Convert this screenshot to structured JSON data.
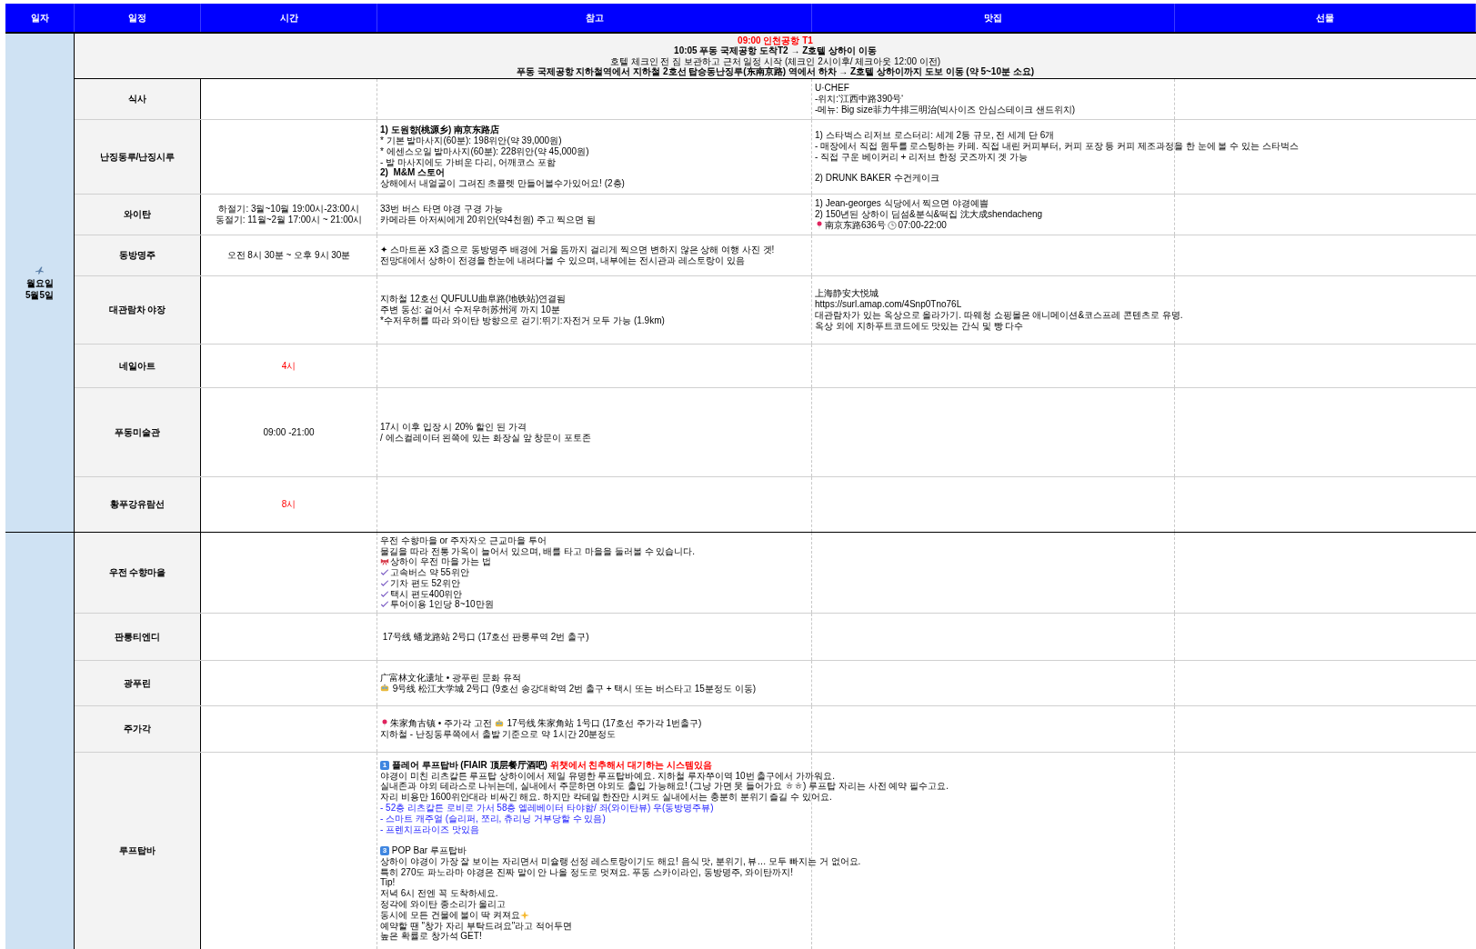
{
  "columns": [
    "일자",
    "일정",
    "시간",
    "참고",
    "맛집",
    "선물"
  ],
  "days": [
    {
      "weekday": "월요일",
      "date": "5월5일",
      "banner": [
        {
          "text": "09:00 인천공항 T1",
          "kind": "alert"
        },
        {
          "text": "10:05 푸동 국제공항 도착T2 →  Z호텔 상하이 이동",
          "kind": "heading"
        },
        {
          "text": "호텔 체크인 전 짐 보관하고 근처 일정 시작 (체크인 2시이후/ 체크아웃 12:00 이전)"
        },
        {
          "text": "푸동 국제공항 지하철역에서 지하철 2호선 탑승동난징루(东南京路) 역에서 하차 → Z호텔 상하이까지 도보 이동 (약 5~10분 소요)",
          "kind": "heading"
        }
      ],
      "rows": [
        {
          "place": "식사",
          "note": [],
          "food": [
            {
              "text": "U·CHEF"
            },
            {
              "text": "-위치:‘江西中路390号‘"
            },
            {
              "text": "-메뉴: Big size菲力牛排三明治(빅사이즈 안심스테이크 샌드위치)"
            }
          ]
        },
        {
          "place": "난징동루/난징시루",
          "note": [
            {
              "text": "1) 도원향(桃源乡) 南京东路店",
              "kind": "heading"
            },
            {
              "text": "* 기본 발마사지(60분): 198위안(약 39,000원)"
            },
            {
              "text": "* 에센스오일 발마사지(60분): 228위안(약 45,000원)"
            },
            {
              "text": "- 발 마사지에도 가벼운 다리, 어깨코스 포함"
            },
            {
              "text": "2)  M&M 스토어",
              "kind": "heading"
            },
            {
              "text": "상해에서 내얼굴이 그려진 초콜렛 만들어볼수가있어요! (2층)"
            }
          ],
          "food": [
            {
              "text": "1) 스타벅스 리저브 로스터리: 세계 2등 규모, 전 세계 단 6개"
            },
            {
              "text": "- 매장에서 직접 원두를 로스팅하는 카페. 직접 내린 커피부터, 커피 포장 등 커피 제조과정을 한 눈에 볼 수 있는 스타벅스"
            },
            {
              "text": "- 직접 구운 베이커리 + 리저브 한정 굿즈까지 겟 가능",
              "gap_after": true
            },
            {
              "text": "2) DRUNK BAKER 수건케이크"
            }
          ]
        },
        {
          "place": "와이탄",
          "time": [
            {
              "text": "하절기: 3월~10월 19:00시-23:00시"
            },
            {
              "text": "동절기: 11월~2월 17:00시 ~ 21:00시"
            }
          ],
          "note": [
            {
              "text": "33번 버스 타면 야경 구경 가능"
            },
            {
              "text": "카메라든 아저씨에게 20위안(약4천원) 주고 찍으면 됨"
            }
          ],
          "food": [
            {
              "text": "1) Jean-georges 식당에서 찍으면 야경예쁨"
            },
            {
              "text": "2) 150년된 상하이 딤섬&분식&떡집 沈大成shendacheng"
            },
            {
              "parts": [
                {
                  "kind": "pin"
                },
                {
                  "text": "南京东路636号 "
                },
                {
                  "kind": "clock"
                },
                {
                  "text": "07:00-22:00"
                }
              ]
            }
          ]
        },
        {
          "place": "동방명주",
          "time": [
            {
              "text": "오전 8시 30분 ~ 오후 9시 30분"
            }
          ],
          "note": [
            {
              "text": "✦ 스마트폰 x3 줌으로 동방명주 배경에 거울 돔까지 걸리게 찍으면 변하지 않은 상해 여행 사진 겟!"
            },
            {
              "text": "전망대에서 상하이 전경을 한눈에 내려다볼 수 있으며, 내부에는 전시관과 레스토랑이 있음"
            }
          ],
          "food": []
        },
        {
          "place": "대관람차 야장",
          "note": [
            {
              "text": "지하철 12호선 QUFULU曲阜路(地铁站)연결됨"
            },
            {
              "text": "주변 동선: 걸어서 수저우허苏州河 까지 10분"
            },
            {
              "text": "*수저우허를 따라 와이탄 방향으로 걷기:뛰기:자전거 모두 가능 (1.9km)"
            }
          ],
          "food": [
            {
              "text": "上海静安大悦城"
            },
            {
              "text": "https://surl.amap.com/4Snp0Tno76L"
            },
            {
              "text": "대관람차가 있는 옥상으로 올라가기. 따웨청 쇼핑몰은 애니메이션&코스프레 콘텐츠로 유명."
            },
            {
              "text": "옥상 외에 지하푸트코드에도 맛있는 간식 및 빵 다수"
            }
          ]
        },
        {
          "place": "네일아트",
          "time": [
            {
              "text": "4시",
              "kind": "highlight"
            }
          ],
          "note": [],
          "food": []
        },
        {
          "place": "푸동미술관",
          "time": [
            {
              "text": "09:00 -21:00"
            }
          ],
          "note": [
            {
              "text": "17시 이후 입장 시 20% 할인 된 가격"
            },
            {
              "text": "/ 에스컬레이터 왼쪽에 있는 화장실 앞 창문이 포토존"
            }
          ],
          "food": []
        },
        {
          "place": "황푸강유람선",
          "time": [
            {
              "text": "8시",
              "kind": "highlight"
            }
          ],
          "note": [],
          "food": []
        }
      ]
    },
    {
      "rows": [
        {
          "place": "우전 수향마을",
          "note": [
            {
              "text": "우전 수향마을 or 주자자오 근교마을 투어"
            },
            {
              "text": "물길을 따라 전통 가옥이 늘어서 있으며, 배를 타고 마을을 둘러볼 수 있습니다."
            },
            {
              "parts": [
                {
                  "kind": "ribbon"
                },
                {
                  "text": "상하이 우전 마을 가는 법"
                }
              ]
            },
            {
              "parts": [
                {
                  "kind": "check"
                },
                {
                  "text": "고속버스 약 55위안"
                }
              ]
            },
            {
              "parts": [
                {
                  "kind": "check"
                },
                {
                  "text": "기차 편도 52위안"
                }
              ]
            },
            {
              "parts": [
                {
                  "kind": "check"
                },
                {
                  "text": "택시 편도400위안"
                }
              ]
            },
            {
              "parts": [
                {
                  "kind": "check"
                },
                {
                  "text": "투어이용 1인당 8~10만원"
                }
              ]
            }
          ],
          "food": []
        },
        {
          "place": "판룽티엔디",
          "note": [
            {
              "text": " 17号线 蟠龙路站 2号口 (17호선 판룽루역 2번 출구)"
            }
          ],
          "food": []
        },
        {
          "place": "광푸린",
          "note": [
            {
              "text": "广富林文化遗址 • 광푸린 문화 유적"
            },
            {
              "parts": [
                {
                  "kind": "tram"
                },
                {
                  "text": " 9号线 松江大学城 2号口 (9호선 송강대학역 2번 출구 + 택시 또는 버스타고 15분정도 이동)"
                }
              ]
            }
          ],
          "food": []
        },
        {
          "place": "주가각",
          "note": [
            {
              "parts": [
                {
                  "kind": "pin"
                },
                {
                  "text": "朱家角古镇 • 주가각 고전 "
                },
                {
                  "kind": "tram"
                },
                {
                  "text": " 17号线 朱家角站 1号口 (17호선 주가각 1번출구)"
                }
              ]
            },
            {
              "text": "지하철 - 난징동루쪽에서 출발 기준으로 약 1시간 20분정도"
            }
          ],
          "food": []
        },
        {
          "place": "루프탑바",
          "note": [
            {
              "parts": [
                {
                  "kind": "keycap",
                  "text": "1"
                },
                {
                  "text": " 플레어 루프탑바 (FIAIR 顶层餐厅酒吧) ",
                  "kind": "heading"
                },
                {
                  "text": "위챗에서 친추해서 대기하는 시스템있음",
                  "kind": "alert"
                }
              ]
            },
            {
              "text": "야경이 미친 리츠칼튼 루프탑 상하이에서 제일 유명한 루프탑바예요. 지하철 루자쭈이역 10번 출구에서 가까워요."
            },
            {
              "text": "실내존과 야외 테라스로 나뉘는데, 실내에서 주문하면 야외도 출입 가능해요! (그냥 가면 못 들어가요 ㅎㅎ) 루프탑 자리는 사전 예약 필수고요."
            },
            {
              "text": "자리 비용만 1600위안대라 비싸긴 해요. 하지만 칵테일 한잔만 시켜도 실내에서는 충분히 분위기 즐길 수 있어요."
            },
            {
              "text": "- 52층 리츠칼튼 로비로 가서 58층 엘레베이터 타야함/ 좌(와이탄뷰) 우(동방명주뷰)",
              "kind": "detail"
            },
            {
              "text": "- 스마트 캐주얼 (슬리퍼, 쪼리, 츄리닝 거부당할 수 있음)",
              "kind": "detail"
            },
            {
              "text": "- 프렌치프라이즈 맛있음",
              "kind": "detail",
              "gap_after": true
            },
            {
              "parts": [
                {
                  "kind": "keycap",
                  "text": "3"
                },
                {
                  "text": " POP Bar 루프탑바"
                }
              ]
            },
            {
              "text": "상하이 야경이 가장 잘 보이는 자리면서 미슐랭 선정 레스토랑이기도 해요! 음식 맛, 분위기, 뷰… 모두 빠지는 거 없어요."
            },
            {
              "text": "특히 270도 파노라마 야경은 진짜 말이 안 나올 정도로 멋져요. 푸동 스카이라인, 동방명주, 와이탄까지!"
            },
            {
              "text": "Tip!"
            },
            {
              "text": "저녁 6시 전엔 꼭 도착하세요."
            },
            {
              "text": "정각에 와이탄 종소리가 울리고"
            },
            {
              "parts": [
                {
                  "text": "동시에 모든 건물에 불이 딱 켜져요"
                },
                {
                  "kind": "sparkle"
                }
              ]
            },
            {
              "text": "예약할 땐 \"창가 자리 부탁드려요\"라고 적어두면"
            },
            {
              "text": "높은 확률로 창가석 GET!"
            }
          ],
          "food": []
        }
      ]
    }
  ]
}
